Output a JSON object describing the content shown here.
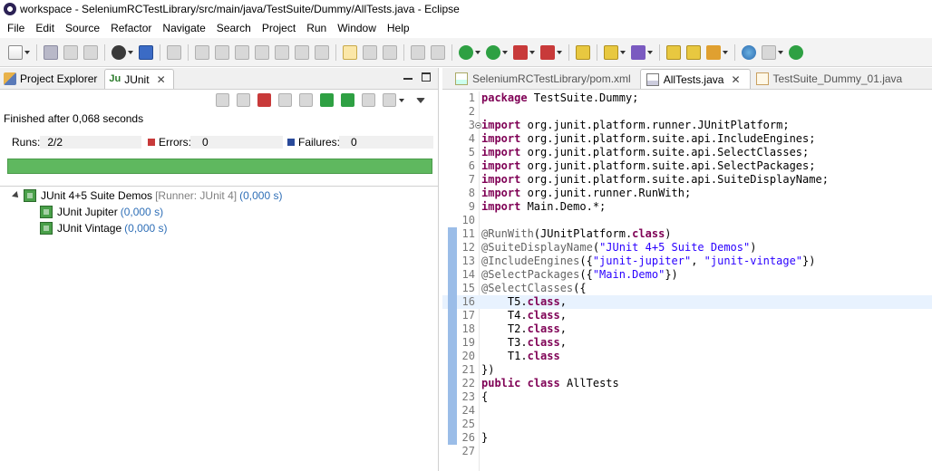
{
  "window": {
    "title": "workspace - SeleniumRCTestLibrary/src/main/java/TestSuite/Dummy/AllTests.java - Eclipse"
  },
  "menu": [
    "File",
    "Edit",
    "Source",
    "Refactor",
    "Navigate",
    "Search",
    "Project",
    "Run",
    "Window",
    "Help"
  ],
  "left_panel": {
    "tabs": [
      {
        "label": "Project Explorer"
      },
      {
        "label": "JUnit"
      }
    ],
    "status": "Finished after 0,068 seconds",
    "runs_label": "Runs:",
    "runs_value": "2/2",
    "errors_label": "Errors:",
    "errors_value": "0",
    "failures_label": "Failures:",
    "failures_value": "0",
    "progress_fraction": 1.0,
    "tree": [
      {
        "name": "JUnit 4+5 Suite Demos",
        "runner": "[Runner: JUnit 4]",
        "time": "(0,000 s)"
      },
      {
        "name": "JUnit Jupiter",
        "time": "(0,000 s)"
      },
      {
        "name": "JUnit Vintage",
        "time": "(0,000 s)"
      }
    ]
  },
  "editor": {
    "tabs": [
      {
        "label": "SeleniumRCTestLibrary/pom.xml"
      },
      {
        "label": "AllTests.java"
      },
      {
        "label": "TestSuite_Dummy_01.java"
      }
    ],
    "lines": [
      "package TestSuite.Dummy;",
      "",
      "import org.junit.platform.runner.JUnitPlatform;",
      "import org.junit.platform.suite.api.IncludeEngines;",
      "import org.junit.platform.suite.api.SelectClasses;",
      "import org.junit.platform.suite.api.SelectPackages;",
      "import org.junit.platform.suite.api.SuiteDisplayName;",
      "import org.junit.runner.RunWith;",
      "import Main.Demo.*;",
      "",
      "@RunWith(JUnitPlatform.class)",
      "@SuiteDisplayName(\"JUnit 4+5 Suite Demos\")",
      "@IncludeEngines({\"junit-jupiter\", \"junit-vintage\"})",
      "@SelectPackages({\"Main.Demo\"})",
      "@SelectClasses({",
      "    T5.class,",
      "    T4.class,",
      "    T2.class,",
      "    T3.class,",
      "    T1.class",
      "})",
      "public class AllTests",
      "{",
      "",
      "",
      "}",
      ""
    ],
    "line_numbers": [
      "1",
      "2",
      "3",
      "4",
      "5",
      "6",
      "7",
      "8",
      "9",
      "10",
      "11",
      "12",
      "13",
      "14",
      "15",
      "16",
      "17",
      "18",
      "19",
      "20",
      "21",
      "22",
      "23",
      "24",
      "25",
      "26",
      "27"
    ],
    "current_line": 16
  }
}
